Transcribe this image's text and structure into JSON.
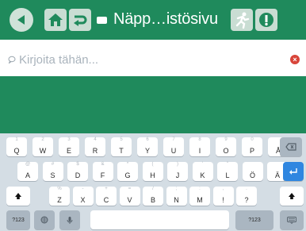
{
  "toolbar": {
    "title": "Näpp…istösivu"
  },
  "input": {
    "placeholder": "Kirjoita tähän...",
    "value": ""
  },
  "keyboard": {
    "row1": [
      "Q",
      "W",
      "E",
      "R",
      "T",
      "Y",
      "U",
      "I",
      "O",
      "P",
      "Å"
    ],
    "row2": [
      "A",
      "S",
      "D",
      "F",
      "G",
      "H",
      "J",
      "K",
      "L",
      "Ö",
      "Ä"
    ],
    "row3": [
      "Z",
      "X",
      "C",
      "V",
      "B",
      "N",
      "M",
      "!",
      "?"
    ],
    "row1_hints": [
      "1",
      "2",
      "3",
      "4",
      "5",
      "6",
      "7",
      "8",
      "9",
      "0",
      ""
    ],
    "row2_hints": [
      "@",
      "#",
      "$",
      "&",
      "*",
      "(",
      ")",
      "'",
      "\"",
      "",
      ""
    ],
    "row3_hints": [
      "%",
      "-",
      "+",
      "=",
      "/",
      ";",
      ":",
      ",",
      "."
    ],
    "numbers_left": "?123",
    "numbers_right": "?123"
  },
  "colors": {
    "brand_green": "#1f8a5c",
    "keyboard_bg": "#d4dde4",
    "enter_blue": "#2f86e0",
    "clear_red": "#d8453a"
  }
}
